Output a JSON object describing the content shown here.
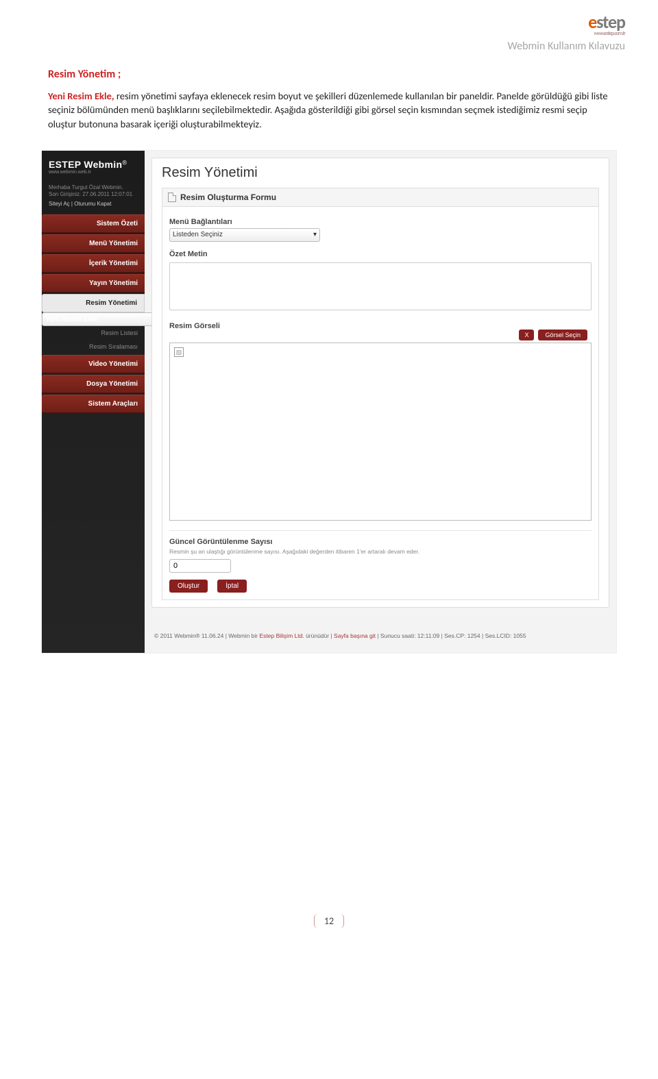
{
  "header": {
    "logo_a": "e",
    "logo_b": "step",
    "logo_sub": "www.estep.com.tr",
    "doc_title": "Webmin Kullanım Kılavuzu"
  },
  "section": {
    "title": "Resim Yönetim ;",
    "lead": "Yeni Resim Ekle, ",
    "body": "resim yönetimi sayfaya eklenecek resim boyut ve şekilleri düzenlemede kullanılan bir paneldir. Panelde görüldüğü gibi liste seçiniz bölümünden menü başlıklarını seçilebilmektedir. Aşağıda gösterildiği gibi görsel seçin kısmından seçmek istediğimiz resmi seçip oluştur butonuna basarak içeriği oluşturabilmekteyiz."
  },
  "app": {
    "brand": "ESTEP Webmin",
    "reg": "®",
    "brand_sub": "www.webmin.web.tr",
    "welcome_line1": "Merhaba Turgut Özal Webmin.",
    "welcome_line2": "Son Girişiniz: 27.06.2011 12:07:01",
    "welcome_links": "Siteyi Aç | Oturumu Kapat",
    "menu": {
      "sistem_ozeti": "Sistem Özeti",
      "menu_yonetimi": "Menü Yönetimi",
      "icerik_yonetimi": "İçerik Yönetimi",
      "yayin_yonetimi": "Yayın Yönetimi",
      "resim_yonetimi": "Resim Yönetimi",
      "video_yonetimi": "Video Yönetimi",
      "dosya_yonetimi": "Dosya Yönetimi",
      "sistem_araclari": "Sistem Araçları"
    },
    "submenu": {
      "yeni_resim_ekle": "Yeni Resim Ekle",
      "resim_listesi": "Resim Listesi",
      "resim_siralamasi": "Resim Sıralaması"
    },
    "page_title": "Resim Yönetimi",
    "panel_title": "Resim Oluşturma Formu",
    "label_menu": "Menü Bağlantıları",
    "select_placeholder": "Listeden Seçiniz",
    "label_ozet": "Özet Metin",
    "label_gorsel": "Resim Görseli",
    "btn_x": "X",
    "btn_gorsel": "Görsel Seçin",
    "label_sayac": "Güncel Görüntülenme Sayısı",
    "hint_sayac": "Resmin şu an ulaştığı görüntülenme sayısı. Aşağıdaki değerden itibaren 1'er artaralı devam eder.",
    "count_value": "0",
    "btn_olustur": "Oluştur",
    "btn_iptal": "İptal"
  },
  "footer": {
    "p1": "© 2011 Webmin® 11.06.24 | Webmin bir ",
    "link1": "Estep Bilişim Ltd.",
    "p2": " ürünüdür | ",
    "link2": "Sayfa başına git",
    "p3": " | Sunucu saati: 12:11:09 | Ses.CP: 1254 | Ses.LCID: 1055"
  },
  "page_num": "12"
}
